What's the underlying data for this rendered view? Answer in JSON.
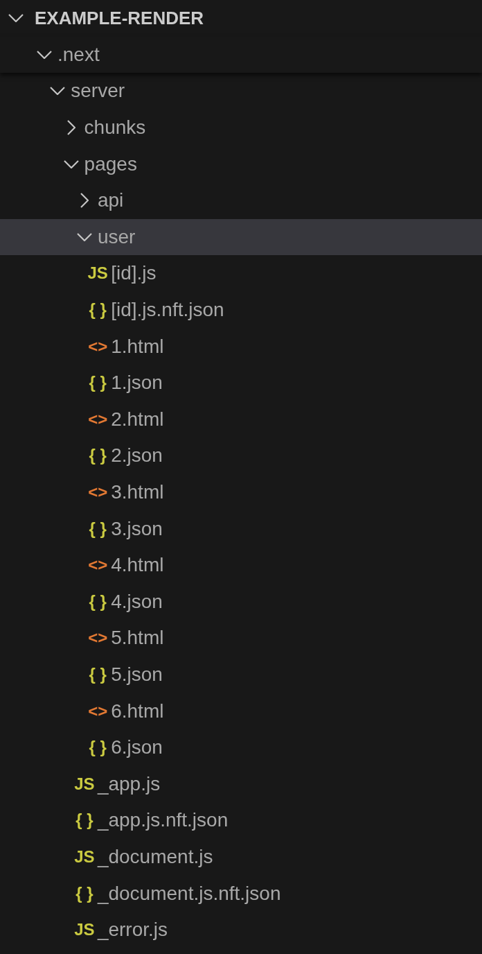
{
  "explorer": {
    "title": "EXAMPLE-RENDER",
    "expanded": true,
    "tree": [
      {
        "name": ".next",
        "kind": "folder",
        "expanded": true,
        "selected": false,
        "children": [
          {
            "name": "server",
            "kind": "folder",
            "expanded": true,
            "selected": false,
            "children": [
              {
                "name": "chunks",
                "kind": "folder",
                "expanded": false,
                "selected": false
              },
              {
                "name": "pages",
                "kind": "folder",
                "expanded": true,
                "selected": false,
                "children": [
                  {
                    "name": "api",
                    "kind": "folder",
                    "expanded": false,
                    "selected": false
                  },
                  {
                    "name": "user",
                    "kind": "folder",
                    "expanded": true,
                    "selected": true,
                    "children": [
                      {
                        "name": "[id].js",
                        "kind": "js",
                        "badge": "JS",
                        "selected": false
                      },
                      {
                        "name": "[id].js.nft.json",
                        "kind": "json",
                        "badge": "{ }",
                        "selected": false
                      },
                      {
                        "name": "1.html",
                        "kind": "html",
                        "badge": "<>",
                        "selected": false
                      },
                      {
                        "name": "1.json",
                        "kind": "json",
                        "badge": "{ }",
                        "selected": false
                      },
                      {
                        "name": "2.html",
                        "kind": "html",
                        "badge": "<>",
                        "selected": false
                      },
                      {
                        "name": "2.json",
                        "kind": "json",
                        "badge": "{ }",
                        "selected": false
                      },
                      {
                        "name": "3.html",
                        "kind": "html",
                        "badge": "<>",
                        "selected": false
                      },
                      {
                        "name": "3.json",
                        "kind": "json",
                        "badge": "{ }",
                        "selected": false
                      },
                      {
                        "name": "4.html",
                        "kind": "html",
                        "badge": "<>",
                        "selected": false
                      },
                      {
                        "name": "4.json",
                        "kind": "json",
                        "badge": "{ }",
                        "selected": false
                      },
                      {
                        "name": "5.html",
                        "kind": "html",
                        "badge": "<>",
                        "selected": false
                      },
                      {
                        "name": "5.json",
                        "kind": "json",
                        "badge": "{ }",
                        "selected": false
                      },
                      {
                        "name": "6.html",
                        "kind": "html",
                        "badge": "<>",
                        "selected": false
                      },
                      {
                        "name": "6.json",
                        "kind": "json",
                        "badge": "{ }",
                        "selected": false
                      }
                    ]
                  },
                  {
                    "name": "_app.js",
                    "kind": "js",
                    "badge": "JS",
                    "selected": false
                  },
                  {
                    "name": "_app.js.nft.json",
                    "kind": "json",
                    "badge": "{ }",
                    "selected": false
                  },
                  {
                    "name": "_document.js",
                    "kind": "js",
                    "badge": "JS",
                    "selected": false
                  },
                  {
                    "name": "_document.js.nft.json",
                    "kind": "json",
                    "badge": "{ }",
                    "selected": false
                  },
                  {
                    "name": "_error.js",
                    "kind": "js",
                    "badge": "JS",
                    "selected": false
                  }
                ]
              }
            ]
          }
        ]
      }
    ]
  }
}
